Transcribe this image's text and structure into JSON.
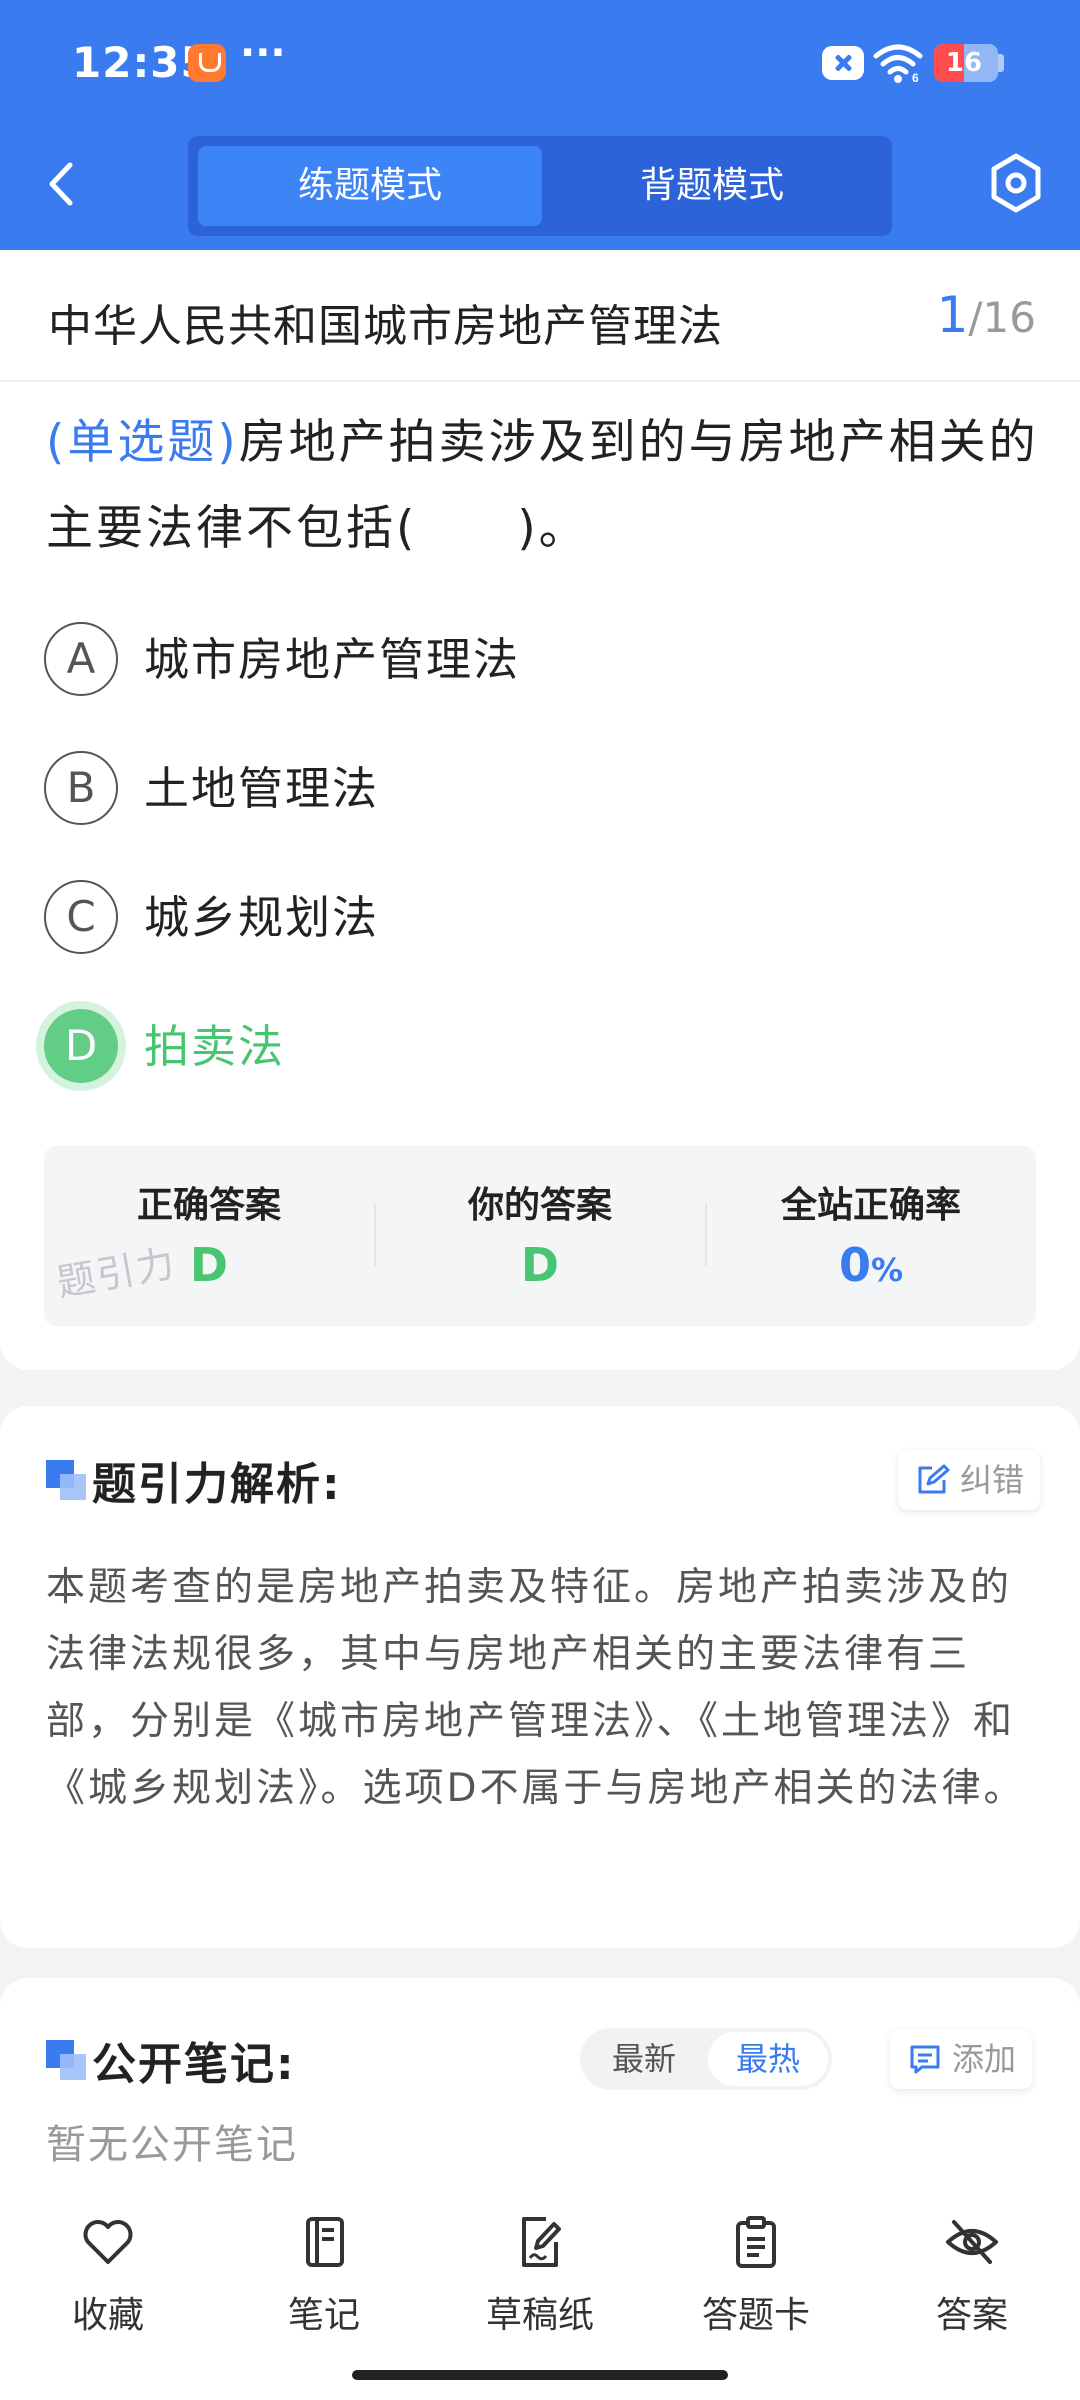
{
  "status_bar": {
    "time": "12:35",
    "more": "···",
    "battery_level": "16"
  },
  "nav": {
    "tabs": [
      {
        "label": "练题模式",
        "active": true
      },
      {
        "label": "背题模式",
        "active": false
      }
    ]
  },
  "question": {
    "law_title": "中华人民共和国城市房地产管理法",
    "progress_current": "1",
    "progress_separator": "/",
    "progress_total": "16",
    "type": "(单选题)",
    "text": "房地产拍卖涉及到的与房地产相关的主要法律不包括(　　)。",
    "options": [
      {
        "letter": "A",
        "text": "城市房地产管理法"
      },
      {
        "letter": "B",
        "text": "土地管理法"
      },
      {
        "letter": "C",
        "text": "城乡规划法"
      },
      {
        "letter": "D",
        "text": "拍卖法",
        "status": "correct"
      }
    ]
  },
  "stats": {
    "correct_answer_label": "正确答案",
    "correct_answer_value": "D",
    "your_answer_label": "你的答案",
    "your_answer_value": "D",
    "site_rate_label": "全站正确率",
    "site_rate_value": "0",
    "site_rate_unit": "%",
    "watermark": "题引力"
  },
  "analysis": {
    "title": "题引力解析:",
    "report_label": "纠错",
    "text": "本题考查的是房地产拍卖及特征。房地产拍卖涉及的法律法规很多，其中与房地产相关的主要法律有三部，分别是《城市房地产管理法》、《土地管理法》和《城乡规划法》。选项D不属于与房地产相关的法律。"
  },
  "notes": {
    "title": "公开笔记:",
    "sort_latest": "最新",
    "sort_hot": "最热",
    "add_label": "添加",
    "empty_text": "暂无公开笔记"
  },
  "toolbar": {
    "items": [
      {
        "label": "收藏",
        "icon": "heart-icon"
      },
      {
        "label": "笔记",
        "icon": "notebook-icon"
      },
      {
        "label": "草稿纸",
        "icon": "draft-paper-icon"
      },
      {
        "label": "答题卡",
        "icon": "answer-sheet-icon"
      },
      {
        "label": "答案",
        "icon": "eye-off-icon"
      }
    ]
  },
  "colors": {
    "primary": "#3b7bf0",
    "correct": "#48c571",
    "text": "#222222",
    "muted": "#999999"
  }
}
